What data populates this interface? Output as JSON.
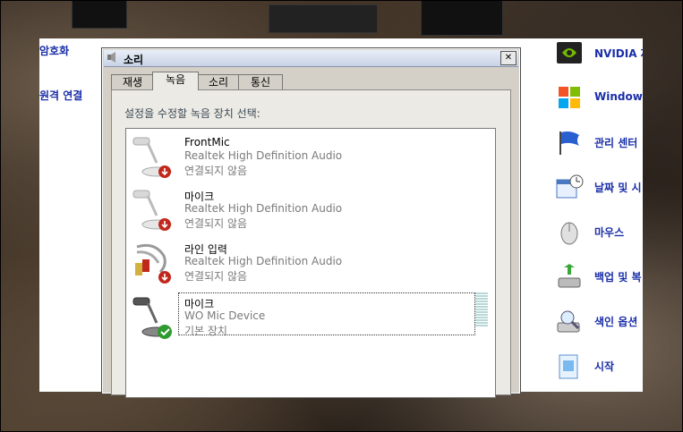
{
  "panel": {
    "left_links": [
      "암호화",
      "원격 연결"
    ],
    "right_items": [
      {
        "label": "NVIDIA 제",
        "icon": "nvidia-icon"
      },
      {
        "label": "Windows",
        "icon": "windows-icon"
      },
      {
        "label": "관리 센터",
        "icon": "flag-icon"
      },
      {
        "label": "날짜 및 시",
        "icon": "calendar-clock-icon"
      },
      {
        "label": "마우스",
        "icon": "mouse-icon"
      },
      {
        "label": "백업 및 복",
        "icon": "backup-icon"
      },
      {
        "label": "색인 옵션",
        "icon": "index-icon"
      },
      {
        "label": "시작",
        "icon": "start-icon"
      }
    ]
  },
  "dialog": {
    "title": "소리",
    "close_label": "✕",
    "tabs": [
      "재생",
      "녹음",
      "소리",
      "통신"
    ],
    "active_tab": "녹음",
    "instruction": "설정을 수정할 녹음 장치 선택:",
    "devices": [
      {
        "name": "FrontMic",
        "description": "Realtek High Definition Audio",
        "status": "연결되지 않음",
        "icon": "microphone-icon",
        "badge": "disconnected"
      },
      {
        "name": "마이크",
        "description": "Realtek High Definition Audio",
        "status": "연결되지 않음",
        "icon": "microphone-icon",
        "badge": "disconnected"
      },
      {
        "name": "라인 입력",
        "description": "Realtek High Definition Audio",
        "status": "연결되지 않음",
        "icon": "line-in-cable-icon",
        "badge": "disconnected"
      },
      {
        "name": "마이크",
        "description": "WO Mic Device",
        "status": "기본 장치",
        "icon": "microphone-icon",
        "badge": "default",
        "selected": true
      }
    ]
  },
  "colors": {
    "link": "#1a2ea8",
    "dialog_face": "#d4d0c8",
    "disabled_text": "#7a7a7a",
    "disconnected_badge": "#c0281c",
    "default_badge": "#2f9a2f"
  }
}
